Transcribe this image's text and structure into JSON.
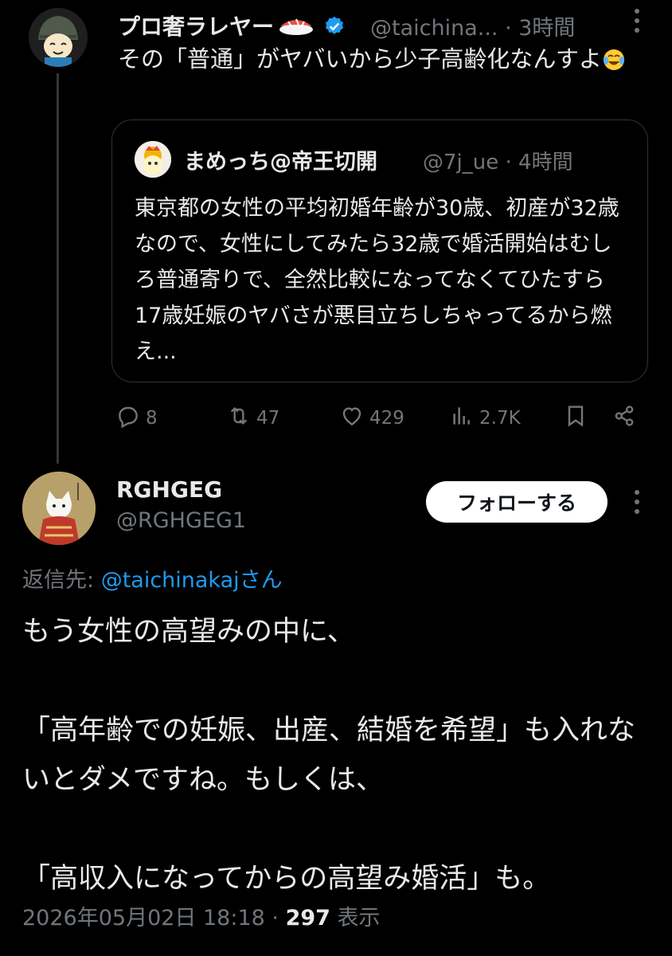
{
  "parent_tweet": {
    "display_name": "プロ奢ラレヤー",
    "handle": "@taichina...",
    "time": "· 3時間",
    "text": "その「普通」がヤバいから少子高齢化なんすよ",
    "emoji": "😂",
    "quoted": {
      "display_name": "まめっち@帝王切開",
      "handle": "@7j_ue",
      "time": "· 4時間",
      "text": "東京都の女性の平均初婚年齢が30歳、初産が32歳なので、女性にしてみたら32歳で婚活開始はむしろ普通寄りで、全然比較になってなくてひたすら17歳妊娠のヤバさが悪目立ちしちゃってるから燃え..."
    },
    "actions": {
      "replies": "8",
      "reposts": "47",
      "likes": "429",
      "views": "2.7K"
    }
  },
  "reply_tweet": {
    "display_name": "RGHGEG",
    "handle": "@RGHGEG1",
    "follow_label": "フォローする",
    "reply_to_prefix": "返信先: ",
    "reply_to_handle": "@taichinakaj",
    "reply_to_suffix": "さん",
    "text": "もう女性の高望みの中に、\n\n「高年齢での妊娠、出産、結婚を希望」も入れないとダメですね。もしくは、\n\n「高収入になってからの高望み婚活」も。",
    "timestamp": "2026年05月02日 18:18 · ",
    "views": "297",
    "views_label": " 表示"
  },
  "colors": {
    "background": "#000000",
    "text": "#e7e9ea",
    "muted": "#71767b",
    "link": "#1d9bf0",
    "border": "#2f3336"
  }
}
